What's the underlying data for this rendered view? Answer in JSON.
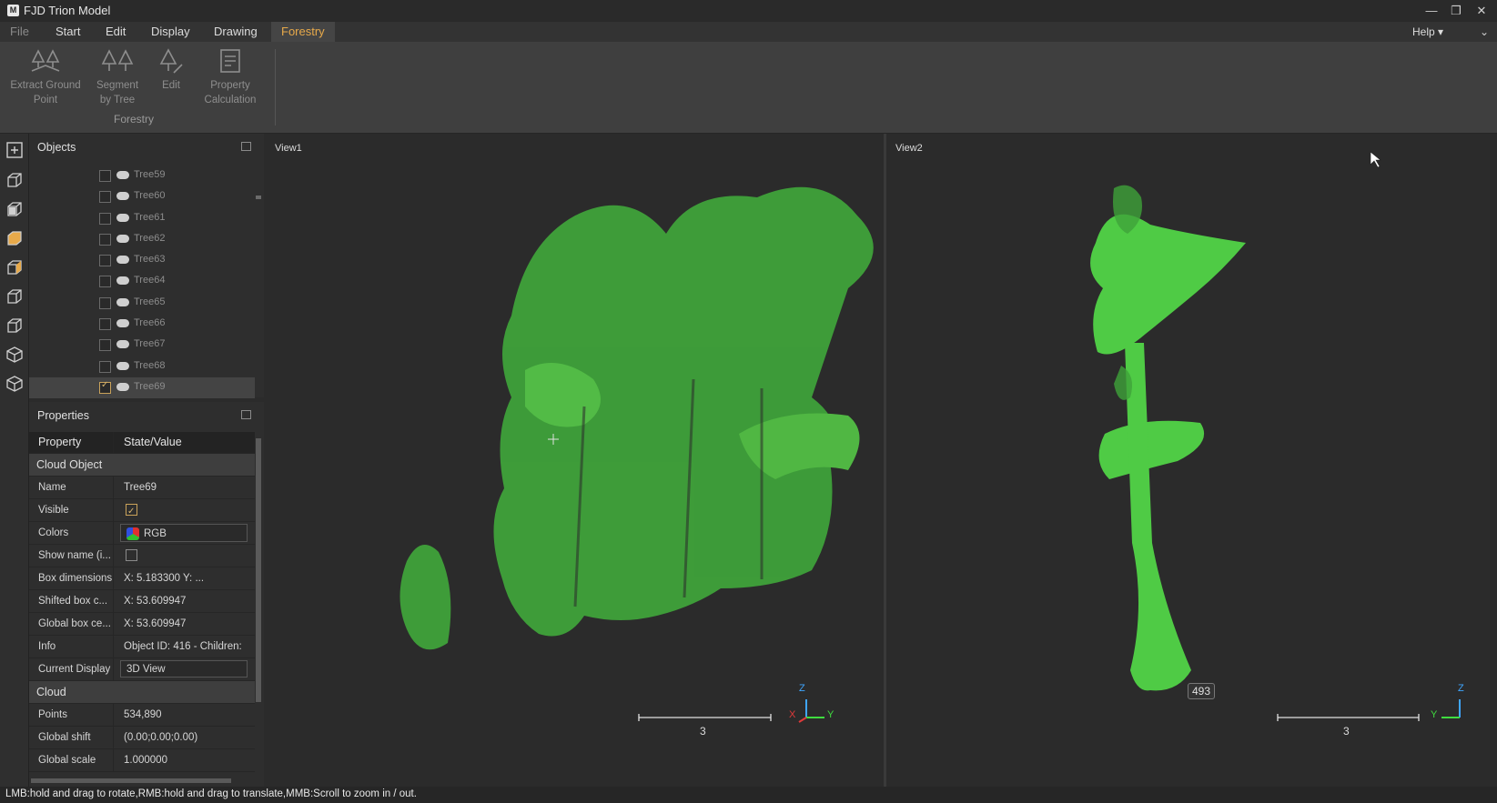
{
  "window": {
    "title": "FJD Trion Model"
  },
  "menu": {
    "items": [
      "File",
      "Start",
      "Edit",
      "Display",
      "Drawing",
      "Forestry"
    ],
    "active": "Forestry",
    "help": "Help"
  },
  "ribbon": {
    "buttons": [
      {
        "label1": "Extract Ground",
        "label2": "Point"
      },
      {
        "label1": "Segment",
        "label2": "by Tree"
      },
      {
        "label1": "Edit",
        "label2": ""
      },
      {
        "label1": "Property",
        "label2": "Calculation"
      }
    ],
    "group_label": "Forestry"
  },
  "objects": {
    "title": "Objects",
    "items": [
      {
        "label": "Tree59",
        "checked": false
      },
      {
        "label": "Tree60",
        "checked": false
      },
      {
        "label": "Tree61",
        "checked": false
      },
      {
        "label": "Tree62",
        "checked": false
      },
      {
        "label": "Tree63",
        "checked": false
      },
      {
        "label": "Tree64",
        "checked": false
      },
      {
        "label": "Tree65",
        "checked": false
      },
      {
        "label": "Tree66",
        "checked": false
      },
      {
        "label": "Tree67",
        "checked": false
      },
      {
        "label": "Tree68",
        "checked": false
      },
      {
        "label": "Tree69",
        "checked": true
      }
    ]
  },
  "properties": {
    "title": "Properties",
    "col_property": "Property",
    "col_value": "State/Value",
    "section_cloud_object": "Cloud Object",
    "name_key": "Name",
    "name_val": "Tree69",
    "visible_key": "Visible",
    "colors_key": "Colors",
    "colors_val": "RGB",
    "showname_key": "Show name (i...",
    "boxdim_key": "Box dimensions",
    "boxdim_val": "X: 5.183300 Y: ...",
    "shifted_key": "Shifted box c...",
    "shifted_val": "X: 53.609947",
    "global_key": "Global box ce...",
    "global_val": "X: 53.609947",
    "info_key": "Info",
    "info_val": "Object ID: 416 - Children:",
    "display_key": "Current Display",
    "display_val": "3D View",
    "section_cloud": "Cloud",
    "points_key": "Points",
    "points_val": "534,890",
    "gshift_key": "Global shift",
    "gshift_val": "(0.00;0.00;0.00)",
    "gscale_key": "Global scale",
    "gscale_val": "1.000000"
  },
  "view1": {
    "label": "View1",
    "scale_label": "3",
    "axis_z": "Z",
    "axis_x": "X",
    "axis_y": "Y"
  },
  "view2": {
    "label": "View2",
    "scale_label": "3",
    "badge": "493",
    "axis_z": "Z",
    "axis_y": "Y"
  },
  "status": {
    "text": "LMB:hold and drag to rotate,RMB:hold and drag to translate,MMB:Scroll to zoom in / out."
  },
  "colors": {
    "accent": "#e7a94a",
    "point_cloud": "#3fa23a",
    "point_cloud_bright": "#5cd24e"
  }
}
